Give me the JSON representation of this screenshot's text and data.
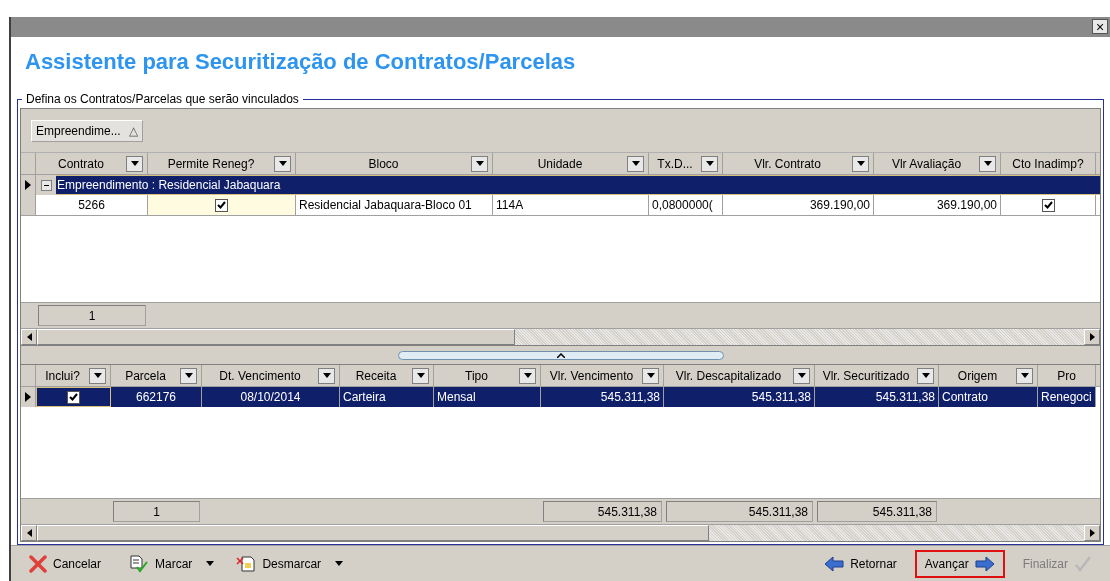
{
  "window": {
    "close": "×",
    "title": "Assistente para Securitização de Contratos/Parcelas"
  },
  "group_box": {
    "legend": "Defina os Contratos/Parcelas que serão vinculados"
  },
  "contracts_grid": {
    "group_by": {
      "label": "Empreendime...",
      "sort": "△"
    },
    "columns": [
      {
        "label": "Contrato",
        "filter": true,
        "total": "1"
      },
      {
        "label": "Permite Reneg?",
        "filter": true
      },
      {
        "label": "Bloco",
        "filter": true
      },
      {
        "label": "Unidade",
        "filter": true
      },
      {
        "label": "Tx.D...",
        "filter": true
      },
      {
        "label": "Vlr. Contrato",
        "filter": true
      },
      {
        "label": "Vlr Avaliação",
        "filter": true
      },
      {
        "label": "Cto Inadimp?",
        "filter": false
      }
    ],
    "groups": [
      {
        "label": "Empreendimento : Residencial Jabaquara",
        "expanded": true,
        "selected": true,
        "rows": [
          {
            "selected": false,
            "cells": [
              {
                "text": "5266"
              },
              {
                "checked": true
              },
              {
                "text": "Residencial Jabaquara-Bloco 01"
              },
              {
                "text": "114A"
              },
              {
                "text": "0,0800000("
              },
              {
                "text": "369.190,00"
              },
              {
                "text": "369.190,00"
              },
              {
                "checked": true
              }
            ]
          }
        ]
      }
    ]
  },
  "installments_grid": {
    "columns": [
      {
        "label": "Inclui?",
        "filter": true
      },
      {
        "label": "Parcela",
        "filter": true,
        "total": "1"
      },
      {
        "label": "Dt. Vencimento",
        "filter": true
      },
      {
        "label": "Receita",
        "filter": true
      },
      {
        "label": "Tipo",
        "filter": true
      },
      {
        "label": "Vlr. Vencimento",
        "filter": true,
        "total": "545.311,38"
      },
      {
        "label": "Vlr. Descapitalizado",
        "filter": true,
        "total": "545.311,38"
      },
      {
        "label": "Vlr. Securitizado",
        "filter": true,
        "total": "545.311,38"
      },
      {
        "label": "Origem",
        "filter": true
      },
      {
        "label": "Pro",
        "filter": false
      }
    ],
    "rows": [
      {
        "selected": true,
        "cells": [
          {
            "checked": true
          },
          {
            "text": "662176"
          },
          {
            "text": "08/10/2014"
          },
          {
            "text": "Carteira"
          },
          {
            "text": "Mensal"
          },
          {
            "text": "545.311,38"
          },
          {
            "text": "545.311,38"
          },
          {
            "text": "545.311,38"
          },
          {
            "text": "Contrato"
          },
          {
            "text": "Renegoci"
          }
        ]
      }
    ]
  },
  "toolbar": [
    {
      "label": "Cancelar",
      "kind": "cancel",
      "menu": false,
      "highlighted": false,
      "disabled": false
    },
    {
      "label": "Marcar",
      "kind": "mark",
      "menu": true,
      "highlighted": false,
      "disabled": false
    },
    {
      "label": "Desmarcar",
      "kind": "unmark",
      "menu": true,
      "highlighted": false,
      "disabled": false
    },
    {
      "label": "Retornar",
      "kind": "back",
      "menu": false,
      "highlighted": false,
      "disabled": false
    },
    {
      "label": "Avançar",
      "kind": "next",
      "menu": false,
      "highlighted": true,
      "disabled": false
    },
    {
      "label": "Finalizar",
      "kind": "finish",
      "menu": false,
      "highlighted": false,
      "disabled": true
    }
  ]
}
